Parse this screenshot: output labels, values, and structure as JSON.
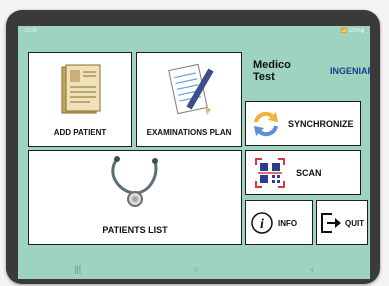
{
  "statusbar": {
    "time": "10:29",
    "indicators": "📶 100%▮"
  },
  "brand": {
    "title": "Medico\nTest",
    "logo": "INGENIARS"
  },
  "tiles": {
    "add_patient": "ADD PATIENT",
    "exam_plan": "EXAMINATIONS PLAN",
    "patients_list": "PATIENTS LIST",
    "synchronize": "SYNCHRONIZE",
    "scan": "SCAN",
    "info": "INFO",
    "quit": "QUIT"
  },
  "navbar": {
    "recent": "|||",
    "home": "○",
    "back": "‹"
  },
  "colors": {
    "background": "#9dd3bf",
    "tile": "#ffffff"
  }
}
